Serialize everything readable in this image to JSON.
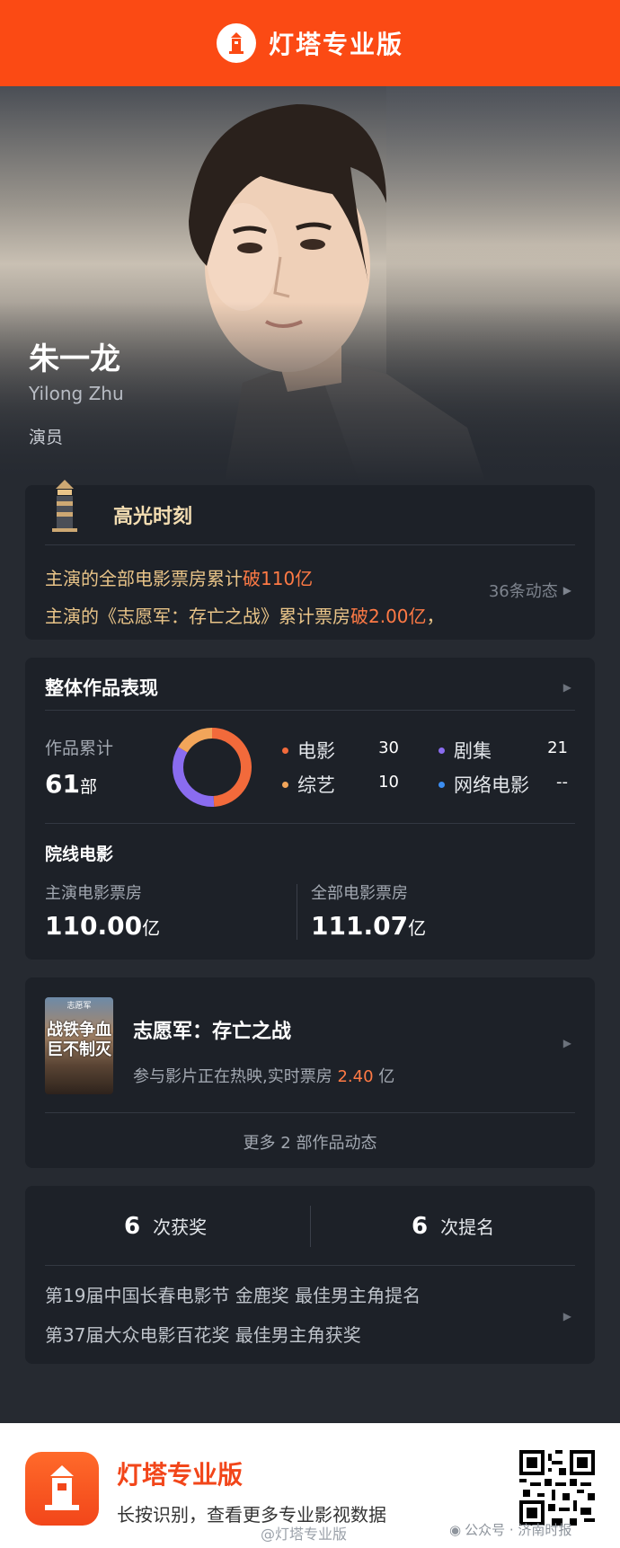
{
  "header": {
    "title": "灯塔专业版"
  },
  "hero": {
    "name_cn": "朱一龙",
    "name_en": "Yilong Zhu",
    "role": "演员"
  },
  "highlights": {
    "title": "高光时刻",
    "line1_prefix": "主演的全部电影票房累计",
    "line1_em": "破110亿",
    "line2_prefix": "主演的《志愿军：存亡之战》累计票房",
    "line2_em": "破2.00亿",
    "line2_suffix": "，",
    "more_label": "36条动态"
  },
  "overall": {
    "title": "整体作品表现",
    "works_label": "作品累计",
    "works_total": "61",
    "works_unit": "部",
    "legend": [
      {
        "label": "电影",
        "value": "30",
        "color": "#f26a3b"
      },
      {
        "label": "剧集",
        "value": "21",
        "color": "#8a6cf0"
      },
      {
        "label": "综艺",
        "value": "10",
        "color": "#f2a55a"
      },
      {
        "label": "网络电影",
        "value": "--",
        "color": "#3c8ef2"
      }
    ],
    "cinema_title": "院线电影",
    "lead_box_label": "主演电影票房",
    "lead_box_value": "110.00",
    "lead_box_unit": "亿",
    "all_box_label": "全部电影票房",
    "all_box_value": "111.07",
    "all_box_unit": "亿"
  },
  "chart_data": {
    "type": "pie",
    "categories": [
      "电影",
      "剧集",
      "综艺",
      "网络电影"
    ],
    "values": [
      30,
      21,
      10,
      0
    ],
    "colors": [
      "#f26a3b",
      "#8a6cf0",
      "#f2a55a",
      "#3c8ef2"
    ]
  },
  "movie": {
    "poster_top": "志愿军",
    "poster_text": "战铁争血巨不制灭",
    "title": "志愿军：存亡之战",
    "status_prefix": "参与影片正在热映,实时票房",
    "status_value": "2.40",
    "status_unit": "亿",
    "more_label": "更多 2 部作品动态"
  },
  "awards": {
    "wins_count": "6",
    "wins_label": "次获奖",
    "noms_count": "6",
    "noms_label": "次提名",
    "items": [
      "第19届中国长春电影节 金鹿奖 最佳男主角提名",
      "第37届大众电影百花奖 最佳男主角获奖"
    ]
  },
  "footer": {
    "title": "灯塔专业版",
    "subtitle": "长按识别，查看更多专业影视数据",
    "watermark": "@灯塔专业版",
    "wechat": "公众号 · 济南时报"
  }
}
